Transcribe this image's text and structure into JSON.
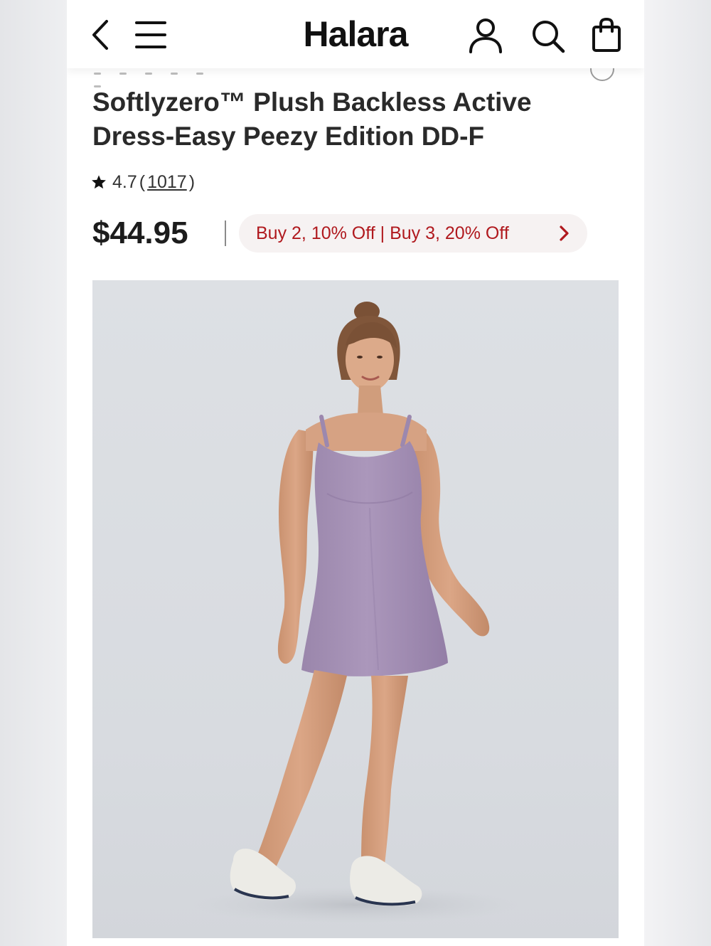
{
  "header": {
    "logo": "Halara",
    "icons": [
      "back-icon",
      "menu-icon",
      "account-icon",
      "search-icon",
      "shopping-bag-icon"
    ]
  },
  "product": {
    "title": "Softlyzero™ Plush Backless Active Dress-Easy Peezy Edition DD-F",
    "rating": "4.7",
    "rating_open": "(",
    "review_count": "1017",
    "rating_close": ")",
    "price": "$44.95",
    "promo": "Buy 2, 10% Off | Buy 3, 20% Off"
  },
  "colors": {
    "promo_text": "#b0191e",
    "promo_bg": "#f6f2f2",
    "dress": "#a48fb3",
    "image_bg": "#dcdfe3"
  }
}
